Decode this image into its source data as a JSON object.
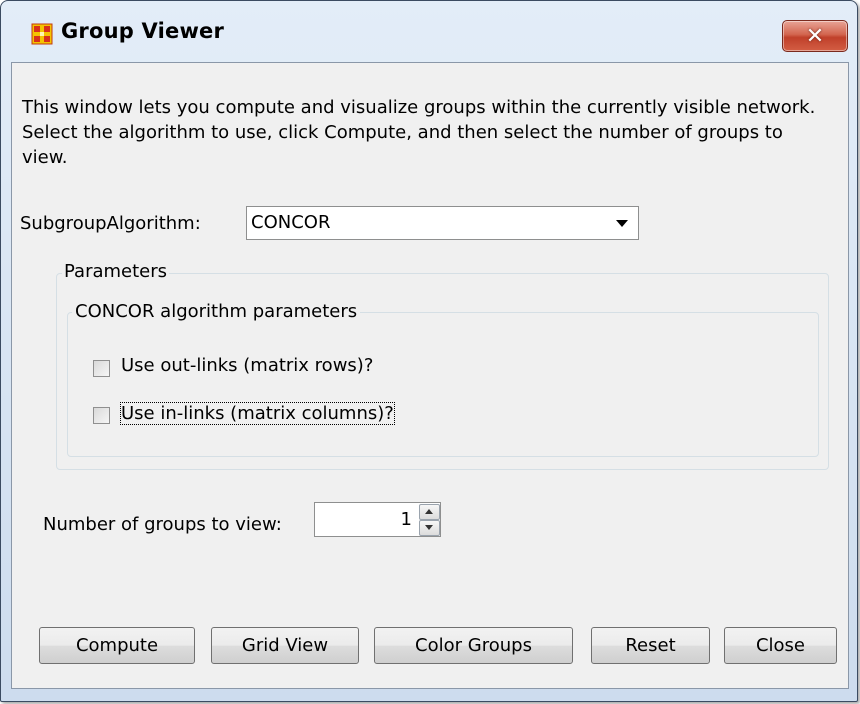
{
  "window": {
    "title": "Group Viewer",
    "close_symbol": "✕",
    "icon": "group-grid-icon",
    "accent_color": "#c0402a"
  },
  "description": "This window lets you compute and visualize groups within the currently visible network. Select the algorithm to use, click Compute, and then select the number of groups to view.",
  "algorithm": {
    "label": "SubgroupAlgorithm:",
    "selected": "CONCOR"
  },
  "parameters": {
    "title": "Parameters",
    "concor": {
      "title": "CONCOR algorithm parameters",
      "options": [
        {
          "label": "Use out-links (matrix rows)?",
          "checked": false
        },
        {
          "label": "Use in-links (matrix columns)?",
          "checked": false
        }
      ]
    }
  },
  "groups": {
    "label": "Number of groups to view:",
    "value": "1"
  },
  "buttons": {
    "compute": "Compute",
    "grid_view": "Grid View",
    "color_groups": "Color Groups",
    "reset": "Reset",
    "close": "Close"
  }
}
